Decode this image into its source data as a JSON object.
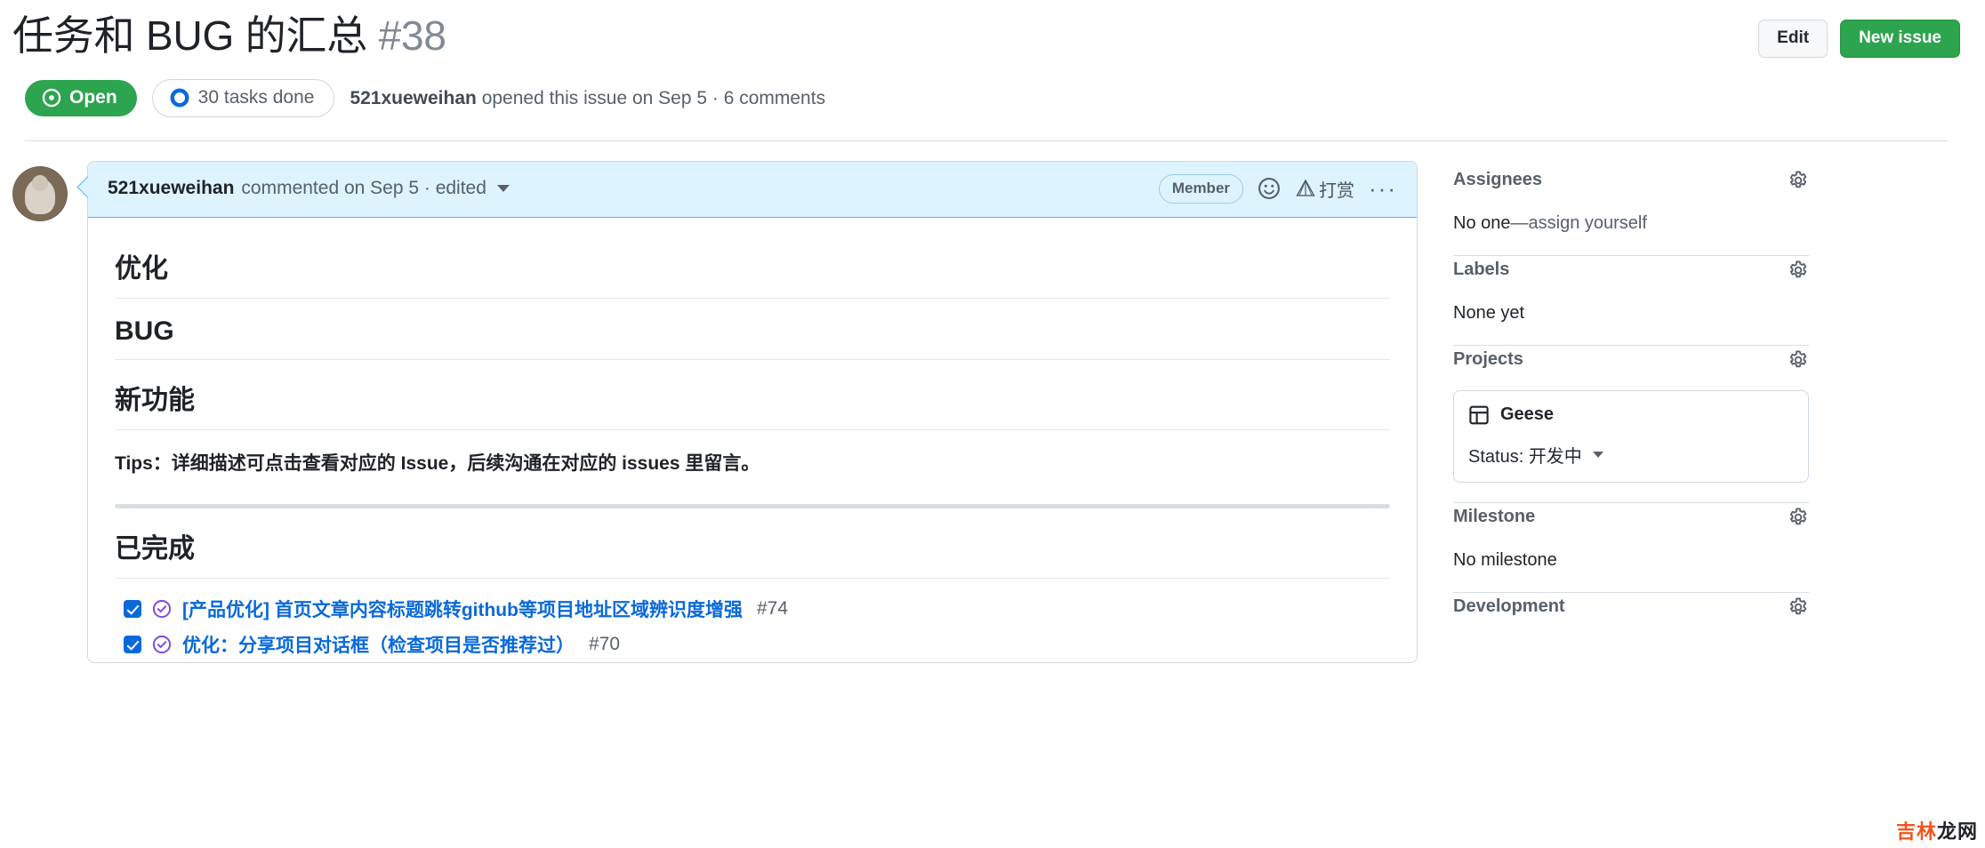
{
  "header": {
    "title": "任务和 BUG 的汇总",
    "number": "#38",
    "edit_label": "Edit",
    "new_issue_label": "New issue",
    "state_label": "Open",
    "tasks_label": "30 tasks done",
    "author": "521xueweihan",
    "meta_text": "opened this issue on Sep 5 · 6 comments"
  },
  "comment": {
    "author": "521xueweihan",
    "subtitle": "commented on Sep 5 · edited",
    "member_badge": "Member",
    "tip_label": "打赏",
    "dots_label": "···",
    "sections": [
      {
        "heading": "优化"
      },
      {
        "heading": "BUG"
      },
      {
        "heading": "新功能"
      }
    ],
    "tips_text": "Tips：详细描述可点击查看对应的 Issue，后续沟通在对应的 issues 里留言。",
    "done_heading": "已完成",
    "tasks": [
      {
        "checked": true,
        "text": "[产品优化] 首页文章内容标题跳转github等项目地址区域辨识度增强",
        "number": "#74"
      },
      {
        "checked": true,
        "text": "优化：分享项目对话框（检查项目是否推荐过）",
        "number": "#70"
      }
    ]
  },
  "sidebar": {
    "assignees": {
      "title": "Assignees",
      "value_strong": "No one",
      "value_link": "—assign yourself"
    },
    "labels": {
      "title": "Labels",
      "value": "None yet"
    },
    "projects": {
      "title": "Projects",
      "project_name": "Geese",
      "status_label": "Status: 开发中"
    },
    "milestone": {
      "title": "Milestone",
      "value": "No milestone"
    },
    "development": {
      "title": "Development"
    }
  },
  "watermark": {
    "part1": "吉林",
    "part2": "龙网"
  },
  "colors": {
    "open_green": "#2da44e",
    "link_blue": "#0969da",
    "closed_purple": "#8250df",
    "comment_blue_bg": "#ddf4ff",
    "comment_blue_border": "#54aeff"
  }
}
